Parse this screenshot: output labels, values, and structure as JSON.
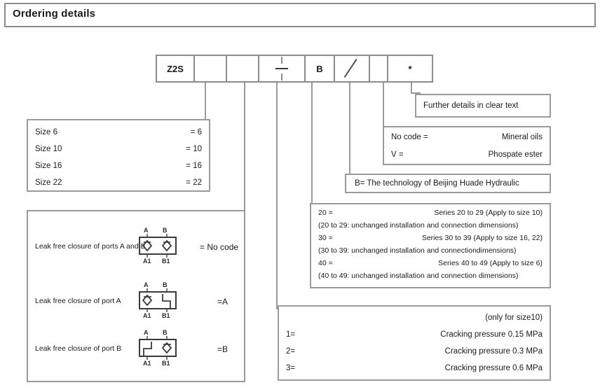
{
  "header": {
    "title": "Ordering details"
  },
  "code_string": {
    "cells": [
      {
        "label": "Z2S",
        "type": "text"
      },
      {
        "label": "",
        "type": "empty"
      },
      {
        "label": "",
        "type": "empty"
      },
      {
        "label": "—",
        "type": "dash"
      },
      {
        "label": "B",
        "type": "text"
      },
      {
        "label": "/",
        "type": "slash"
      },
      {
        "label": "*",
        "type": "asterisk"
      }
    ]
  },
  "size_box": {
    "rows": [
      {
        "label": "Size 6",
        "code": "= 6"
      },
      {
        "label": "Size 10",
        "code": "= 10"
      },
      {
        "label": "Size 16",
        "code": "= 16"
      },
      {
        "label": "Size 22",
        "code": "= 22"
      }
    ]
  },
  "closure_box": {
    "rows": [
      {
        "label": "Leak free closure of ports A and B",
        "code": "= No code",
        "symbol": "check-valve-both",
        "ports_top": [
          "A",
          "B"
        ],
        "ports_bottom": [
          "A1",
          "B1"
        ]
      },
      {
        "label": "Leak free closure of port A",
        "code": "=A",
        "symbol": "check-valve-a",
        "ports_top": [
          "A",
          "B"
        ],
        "ports_bottom": [
          "A1",
          "B1"
        ]
      },
      {
        "label": "Leak free closure of port B",
        "code": "=B",
        "symbol": "check-valve-b",
        "ports_top": [
          "A",
          "B"
        ],
        "ports_bottom": [
          "A1",
          "B1"
        ]
      }
    ]
  },
  "further_details_box": {
    "text": "Further details in clear text"
  },
  "fluid_box": {
    "rows": [
      {
        "code": "No code =",
        "desc": "Mineral oils"
      },
      {
        "code": "V =",
        "desc": "Phospate ester"
      }
    ]
  },
  "technology_box": {
    "text": "B=  The technology of Beijing Huade Hydraulic"
  },
  "series_box": {
    "lines": [
      {
        "code": "20 =",
        "desc": "Series 20 to 29 (Apply to size 10)",
        "split": true
      },
      {
        "note": "(20 to 29: unchanged installation and connection dimensions)",
        "split": false
      },
      {
        "code": "30 =",
        "desc": "Series 30 to 39 (Apply to size 16, 22)",
        "split": true
      },
      {
        "note": "(30 to 39: unchanged installation and connectiondimensions)",
        "split": false
      },
      {
        "code": "40 =",
        "desc": "Series 40 to 49 (Apply to size 6)",
        "split": true
      },
      {
        "note": "(40 to 49: unchanged installation and connection dimensions)",
        "split": false
      }
    ]
  },
  "cracking_box": {
    "note": "(only for size10)",
    "rows": [
      {
        "code": "1=",
        "desc": "Cracking pressure 0.15 MPa"
      },
      {
        "code": "2=",
        "desc": "Cracking pressure 0.3 MPa"
      },
      {
        "code": "3=",
        "desc": "Cracking pressure 0.6 MPa"
      }
    ]
  },
  "colors": {
    "frame": "#9a9a9a",
    "text": "#1a1a1a",
    "background": "#ffffff"
  }
}
